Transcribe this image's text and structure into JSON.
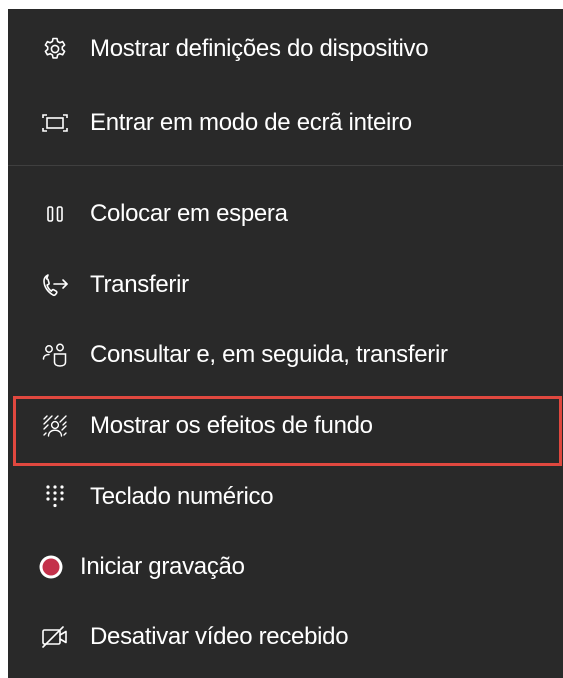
{
  "menu": {
    "items": [
      {
        "icon": "gear-icon",
        "label": "Mostrar definições do dispositivo"
      },
      {
        "icon": "fullscreen-icon",
        "label": "Entrar em modo de ecrã inteiro"
      },
      {
        "icon": "pause-icon",
        "label": "Colocar em espera"
      },
      {
        "icon": "call-transfer-icon",
        "label": "Transferir"
      },
      {
        "icon": "consult-transfer-icon",
        "label": "Consultar e, em seguida, transferir"
      },
      {
        "icon": "background-effects-icon",
        "label": "Mostrar os efeitos de fundo",
        "highlighted": true
      },
      {
        "icon": "dialpad-icon",
        "label": "Teclado numérico"
      },
      {
        "icon": "record-icon",
        "label": "Iniciar gravação"
      },
      {
        "icon": "video-off-icon",
        "label": "Desativar vídeo recebido"
      }
    ]
  },
  "colors": {
    "menu_background": "#292929",
    "text": "#ffffff",
    "highlight_border": "#e0483f",
    "record_red": "#c4314b"
  }
}
